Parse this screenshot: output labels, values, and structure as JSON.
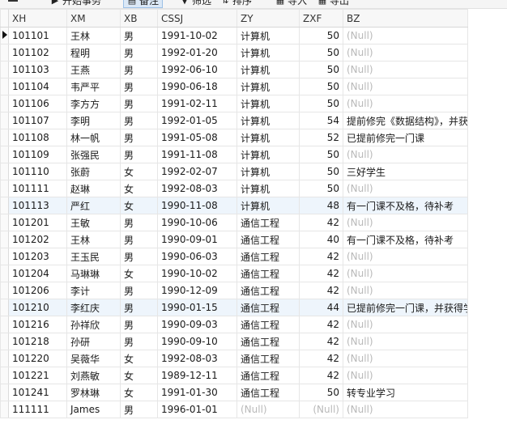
{
  "toolbar": {
    "items": [
      {
        "label": "开始事务",
        "icon": "transaction-icon"
      },
      {
        "label": "备注",
        "icon": "note-icon"
      },
      {
        "label": "筛选",
        "icon": "filter-icon"
      },
      {
        "label": "排序",
        "icon": "sort-icon"
      },
      {
        "label": "导入",
        "icon": "import-icon"
      },
      {
        "label": "导出",
        "icon": "export-icon"
      }
    ]
  },
  "columns": [
    "XH",
    "XM",
    "XB",
    "CSSJ",
    "ZY",
    "ZXF",
    "BZ"
  ],
  "null_text": "(Null)",
  "rows": [
    [
      "101101",
      "王林",
      "男",
      "1991-10-02",
      "计算机",
      "50",
      "(Null)"
    ],
    [
      "101102",
      "程明",
      "男",
      "1992-01-20",
      "计算机",
      "50",
      "(Null)"
    ],
    [
      "101103",
      "王燕",
      "男",
      "1992-06-10",
      "计算机",
      "50",
      "(Null)"
    ],
    [
      "101104",
      "韦严平",
      "男",
      "1990-06-18",
      "计算机",
      "50",
      "(Null)"
    ],
    [
      "101106",
      "李方方",
      "男",
      "1991-02-11",
      "计算机",
      "50",
      "(Null)"
    ],
    [
      "101107",
      "李明",
      "男",
      "1992-01-05",
      "计算机",
      "54",
      "提前修完《数据结构》，并获"
    ],
    [
      "101108",
      "林一帆",
      "男",
      "1991-05-08",
      "计算机",
      "52",
      "已提前修完一门课"
    ],
    [
      "101109",
      "张强民",
      "男",
      "1991-11-08",
      "计算机",
      "50",
      "(Null)"
    ],
    [
      "101110",
      "张蔚",
      "女",
      "1992-02-07",
      "计算机",
      "50",
      "三好学生"
    ],
    [
      "101111",
      "赵琳",
      "女",
      "1992-08-03",
      "计算机",
      "50",
      "(Null)"
    ],
    [
      "101113",
      "严红",
      "女",
      "1990-11-08",
      "计算机",
      "48",
      "有一门课不及格，待补考"
    ],
    [
      "101201",
      "王敏",
      "男",
      "1990-10-06",
      "通信工程",
      "42",
      "(Null)"
    ],
    [
      "101202",
      "王林",
      "男",
      "1990-09-01",
      "通信工程",
      "40",
      "有一门课不及格，待补考"
    ],
    [
      "101203",
      "王玉民",
      "男",
      "1990-06-03",
      "通信工程",
      "42",
      "(Null)"
    ],
    [
      "101204",
      "马琳琳",
      "女",
      "1990-10-02",
      "通信工程",
      "42",
      "(Null)"
    ],
    [
      "101206",
      "李计",
      "男",
      "1990-12-09",
      "通信工程",
      "42",
      "(Null)"
    ],
    [
      "101210",
      "李红庆",
      "男",
      "1990-01-15",
      "通信工程",
      "44",
      "已提前修完一门课，并获得学"
    ],
    [
      "101216",
      "孙祥欣",
      "男",
      "1990-09-03",
      "通信工程",
      "42",
      "(Null)"
    ],
    [
      "101218",
      "孙研",
      "男",
      "1990-09-10",
      "通信工程",
      "42",
      "(Null)"
    ],
    [
      "101220",
      "吴薇华",
      "女",
      "1992-08-03",
      "通信工程",
      "42",
      "(Null)"
    ],
    [
      "101221",
      "刘燕敏",
      "女",
      "1989-12-11",
      "通信工程",
      "42",
      "(Null)"
    ],
    [
      "101241",
      "罗林琳",
      "女",
      "1991-01-30",
      "通信工程",
      "50",
      "转专业学习"
    ],
    [
      "111111",
      "James",
      "男",
      "1996-01-01",
      "(Null)",
      "(Null)",
      "(Null)"
    ]
  ],
  "active_row": 0,
  "colors": {
    "null": "#b9b9b9",
    "alt_row": "#f6f8fb",
    "header_bg": "#f7f7f7"
  }
}
